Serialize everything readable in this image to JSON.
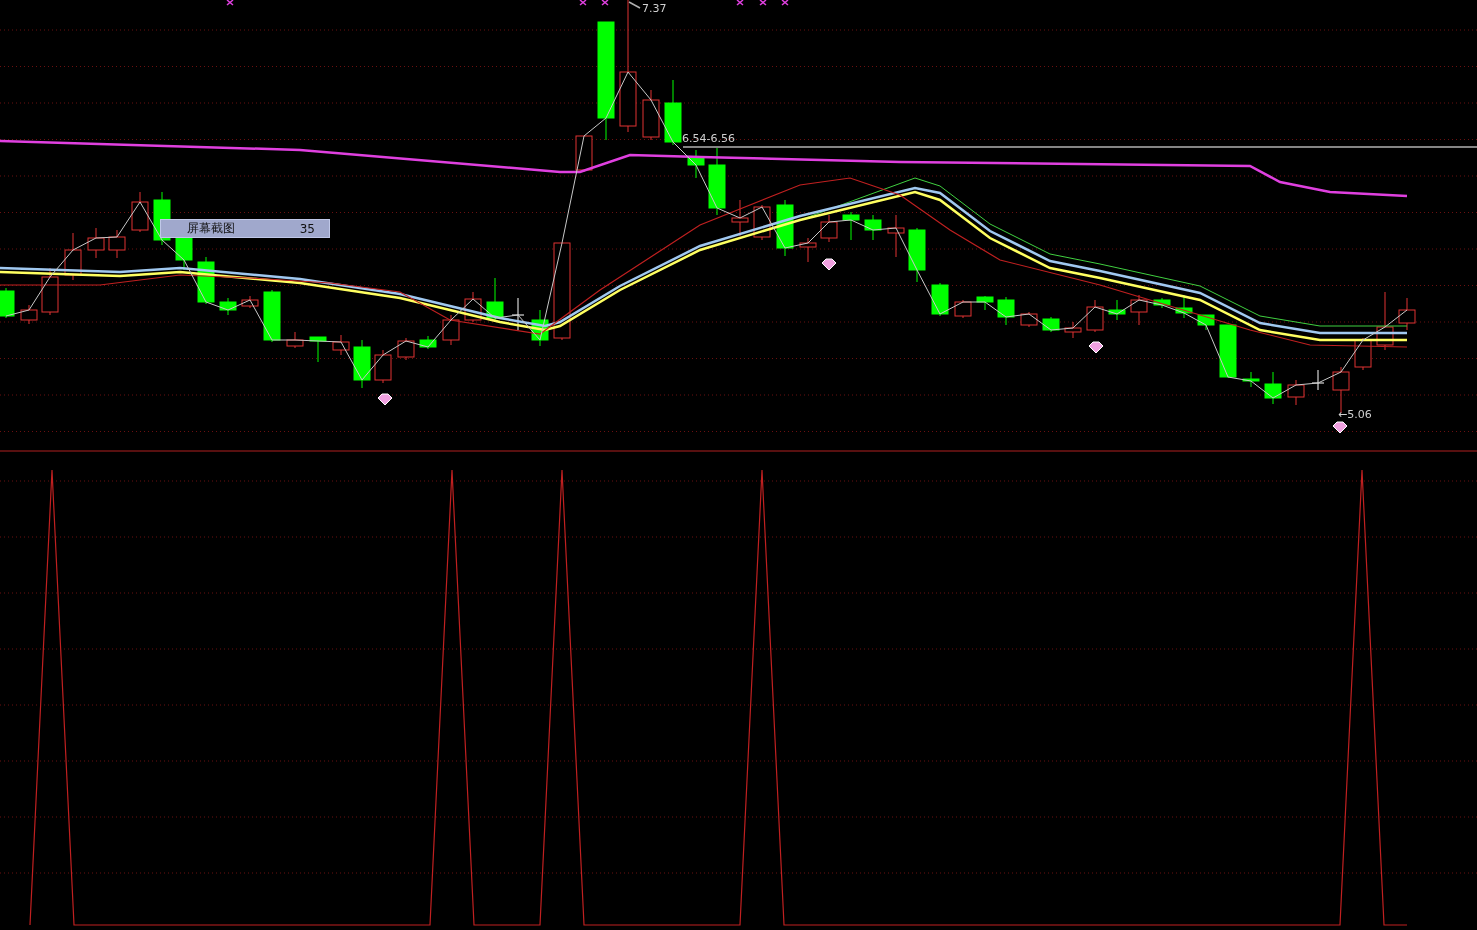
{
  "price_chart": {
    "high_label": "7.37",
    "range_label": "6.54-6.56",
    "low_label": "←5.06"
  },
  "tooltip": {
    "name": "屏幕截图",
    "value": "35"
  }
}
